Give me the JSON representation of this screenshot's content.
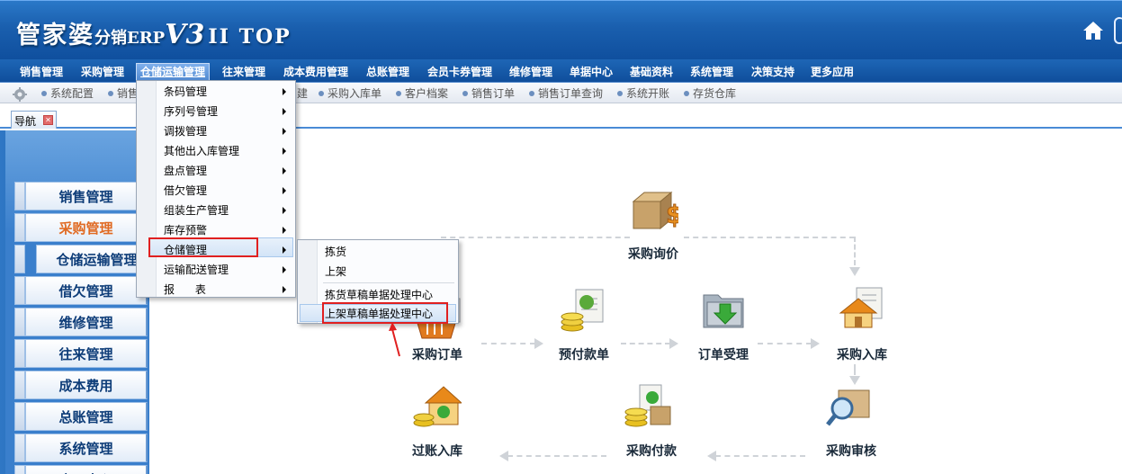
{
  "app": {
    "brand_main": "管家婆",
    "brand_sub": "分销ERP",
    "brand_version": "V3",
    "brand_edition": "II TOP"
  },
  "menubar": {
    "items": [
      "销售管理",
      "采购管理",
      "仓储运输管理",
      "往来管理",
      "成本费用管理",
      "总账管理",
      "会员卡券管理",
      "维修管理",
      "单据中心",
      "基础资料",
      "系统管理",
      "决策支持",
      "更多应用"
    ],
    "active": "仓储运输管理"
  },
  "quickbar": {
    "items": [
      "系统配置",
      "销售",
      "建",
      "采购入库单",
      "客户档案",
      "销售订单",
      "销售订单查询",
      "系统开账",
      "存货仓库"
    ]
  },
  "tab": {
    "label": "导航"
  },
  "leftnav": {
    "items": [
      "销售管理",
      "采购管理",
      "仓储运输管理",
      "借欠管理",
      "维修管理",
      "往来管理",
      "成本费用",
      "总账管理",
      "系统管理",
      "应用中心"
    ],
    "selected": "采购管理"
  },
  "dropdown": {
    "items": [
      "条码管理",
      "序列号管理",
      "调拨管理",
      "其他出入库管理",
      "盘点管理",
      "借欠管理",
      "组装生产管理",
      "库存预警",
      "仓储管理",
      "运输配送管理",
      "报      表"
    ],
    "hovered": "仓储管理"
  },
  "submenu": {
    "items": [
      "拣货",
      "上架",
      "拣货草稿单据处理中心",
      "上架草稿单据处理中心"
    ],
    "hovered": "上架草稿单据处理中心"
  },
  "flow": {
    "inquiry": "采购询价",
    "order": "采购订单",
    "prepay": "预付款单",
    "accept": "订单受理",
    "stockin": "采购入库",
    "posting": "过账入库",
    "payment": "采购付款",
    "audit": "采购审核"
  },
  "colors": {
    "title_bar": "#1a5fae",
    "annotation_red": "#e02020",
    "nav_selected": "#e06a22"
  }
}
